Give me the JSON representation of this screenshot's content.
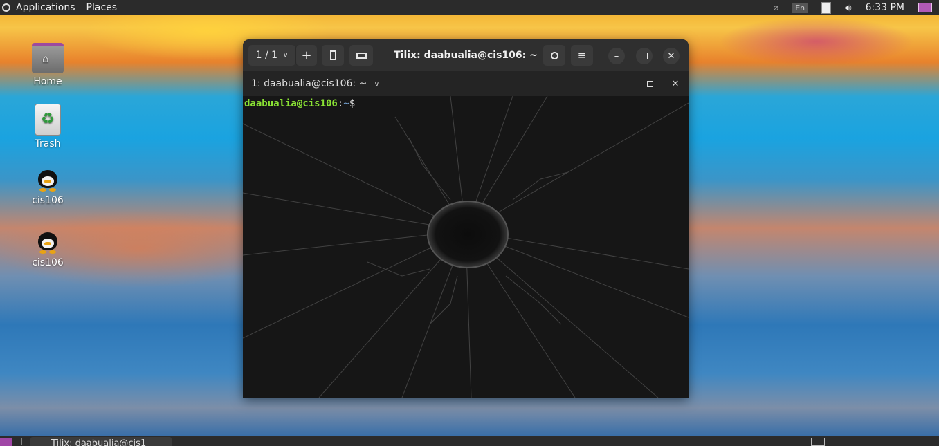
{
  "topbar": {
    "applications_label": "Applications",
    "places_label": "Places",
    "language_indicator": "En",
    "clock": "6:33 PM"
  },
  "desktop": {
    "icons": [
      {
        "label": "Home",
        "icon": "home-folder-icon"
      },
      {
        "label": "Trash",
        "icon": "trash-icon"
      },
      {
        "label": "cis106",
        "icon": "tux-icon"
      },
      {
        "label": "cis106",
        "icon": "tux-icon"
      }
    ]
  },
  "tilix": {
    "session_counter": "1 / 1",
    "window_title": "Tilix: daabualia@cis106: ~",
    "terminal_title": "1: daabualia@cis106: ~",
    "prompt_user": "daabualia@cis106",
    "prompt_sep": ":",
    "prompt_path": "~",
    "prompt_symbol": "$ ",
    "cursor": "_"
  },
  "taskbar": {
    "task_label": "Tilix: daabualia@cis1"
  },
  "colors": {
    "topbar_bg": "#2b2b2b",
    "prompt_user": "#8ae234",
    "prompt_path": "#729fcf",
    "workspace_accent": "#a046a6"
  }
}
